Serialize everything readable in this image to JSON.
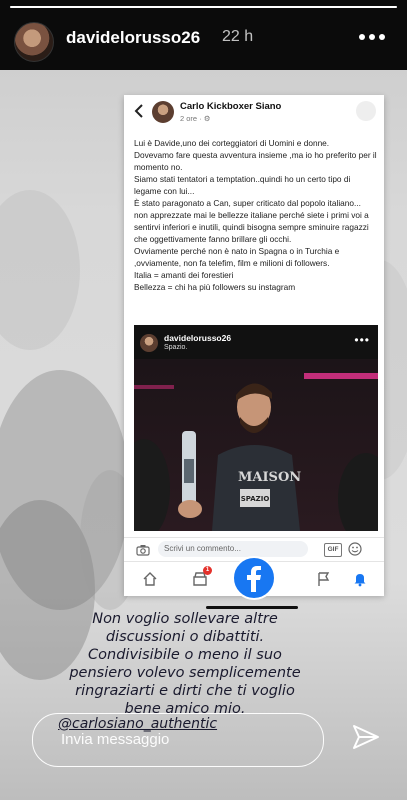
{
  "story": {
    "username": "davidelorusso26",
    "time_ago": "22 h",
    "progress": 1.0
  },
  "fb_post": {
    "author": "Carlo Kickboxer Siano",
    "meta": "2 ore · ⚙",
    "lines": [
      "Lui è Davide,uno dei corteggiatori di Uomini e donne.",
      "Dovevamo fare questa avventura insieme ,ma io ho preferito per il momento no.",
      "Siamo stati tentatori a temptation..quindi ho un certo tipo di legame con lui...",
      "È stato paragonato a Can, super criticato dal popolo italiano...",
      "non apprezzate mai le bellezze italiane perché siete i primi voi a sentirvi inferiori e inutili, quindi bisogna sempre sminuire ragazzi che oggettivamente fanno brillare gli occhi.",
      "Ovviamente perché non è nato in Spagna o in Turchia e ,ovviamente, non fa telefim, film e milioni di followers.",
      "Italia = amanti dei forestieri",
      "Bellezza = chi ha più followers su instagram"
    ],
    "embedded": {
      "username": "davidelorusso26",
      "location": "Spazio.",
      "shirt_text_1": "MAISON",
      "shirt_text_2": "SPAZIO"
    },
    "comment_placeholder": "Scrivi un commento...",
    "gif_label": "GIF",
    "notif_badge": "1"
  },
  "caption": {
    "lines": [
      "Non voglio sollevare altre",
      "discussioni o dibattiti.",
      "Condivisibile o meno il suo",
      "pensiero volevo semplicemente",
      "ringraziarti e dirti che ti voglio",
      "bene amico mio."
    ],
    "mention": "@carlosiano_authentic"
  },
  "reply": {
    "placeholder": "Invia messaggio"
  },
  "colors": {
    "facebook_blue": "#1877f2",
    "badge_red": "#e4312b"
  }
}
